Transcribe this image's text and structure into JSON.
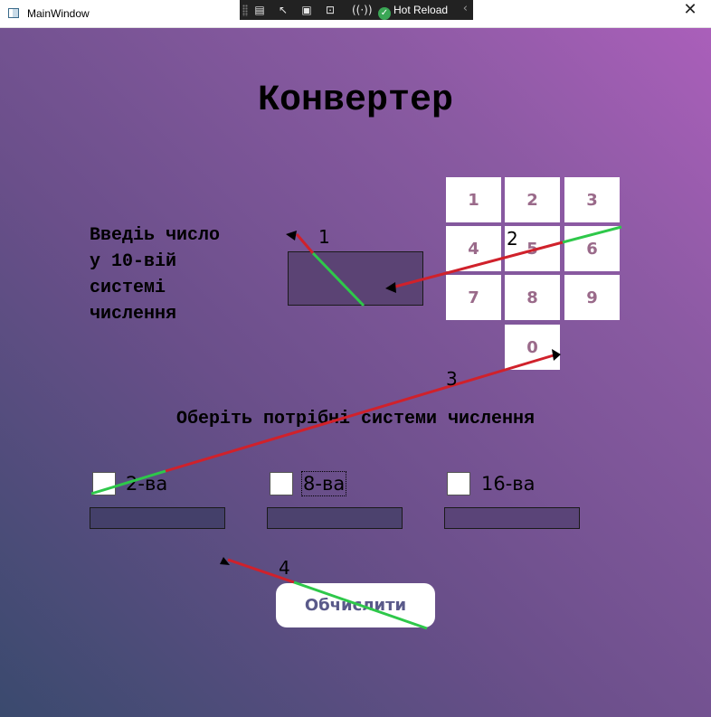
{
  "window": {
    "title": "MainWindow",
    "close_glyph": "✕"
  },
  "toolbar": {
    "hot_reload_label": "Hot Reload"
  },
  "main": {
    "title": "Конвертер",
    "input_label_lines": [
      "Введіь число",
      "у 10-вій",
      "системі",
      "числення"
    ],
    "number_input_value": ""
  },
  "keypad": {
    "keys": [
      "1",
      "2",
      "3",
      "4",
      "5",
      "6",
      "7",
      "8",
      "9",
      "0"
    ]
  },
  "systems": {
    "title": "Оберіть потрібні системи числення",
    "options": [
      {
        "label": "2-ва",
        "checked": false,
        "result": ""
      },
      {
        "label": "8-ва",
        "checked": false,
        "result": ""
      },
      {
        "label": "16-ва",
        "checked": false,
        "result": ""
      }
    ]
  },
  "calculate": {
    "label": "Обчислити"
  },
  "overlay_labels": [
    "1",
    "2",
    "3",
    "4"
  ],
  "colors": {
    "gradient_top_right": "#aa5fba",
    "gradient_bottom_left": "#3a4a6e",
    "input_bg": "#5b4374",
    "key_text": "#9a6a8a",
    "calc_text": "#5a5a8a",
    "line_red": "#d0212b",
    "line_green": "#2ec84a"
  },
  "icons": [
    "app-icon",
    "close-icon",
    "hot-reload-check-icon",
    "chevron-left-icon"
  ]
}
